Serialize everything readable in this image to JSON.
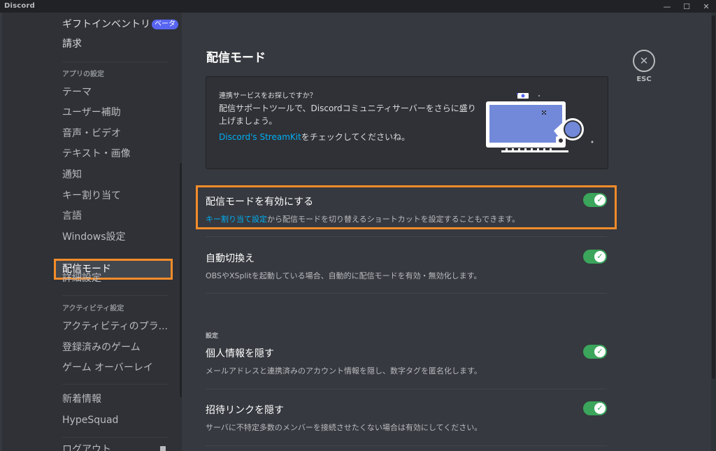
{
  "window": {
    "title": "Discord",
    "controls": {
      "minimize": "—",
      "maximize": "☐",
      "close": "✕"
    }
  },
  "sidebar": {
    "top_items": [
      {
        "label": "ギフトインベントリ",
        "badge": "ベータ"
      },
      {
        "label": "請求"
      }
    ],
    "app_settings_header": "アプリの設定",
    "app_items": [
      "テーマ",
      "ユーザー補助",
      "音声・ビデオ",
      "テキスト・画像",
      "通知",
      "キー割り当て",
      "言語",
      "Windows設定",
      "配信モード",
      "詳細設定"
    ],
    "active_item": "配信モード",
    "activity_header": "アクティビティ設定",
    "activity_items": [
      "アクティビティのプラ...",
      "登録済みのゲーム",
      "ゲーム オーバーレイ"
    ],
    "misc_items": [
      "新着情報",
      "HypeSquad"
    ],
    "logout": "ログアウト"
  },
  "main": {
    "title": "配信モード",
    "esc_label": "ESC",
    "promo": {
      "question": "連携サービスをお探しですか？",
      "description": "配信サポートツールで、Discordコミュニティサーバーをさらに盛り上げましょう。",
      "link_text": "Discord's StreamKit",
      "link_suffix": "をチェックしてくださいね。"
    },
    "settings": [
      {
        "title": "配信モードを有効にする",
        "desc_link": "キー割り当て設定",
        "desc": "から配信モードを切り替えるショートカットを設定することもできます。",
        "enabled": true
      },
      {
        "title": "自動切換え",
        "desc": "OBSやXSplitを起動している場合、自動的に配信モードを有効・無効化します。",
        "enabled": true
      }
    ],
    "section_label": "設定",
    "options": [
      {
        "title": "個人情報を隠す",
        "desc": "メールアドレスと連携済みのアカウント情報を隠し、数字タグを匿名化します。",
        "enabled": true
      },
      {
        "title": "招待リンクを隠す",
        "desc": "サーバに不特定多数のメンバーを接続させたくない場合は有効にしてください。",
        "enabled": true
      }
    ],
    "toggle_check": "✓"
  },
  "colors": {
    "highlight": "#f48c2a",
    "toggle_on": "#3ba55c",
    "link": "#00aff4",
    "accent": "#5865f2"
  }
}
